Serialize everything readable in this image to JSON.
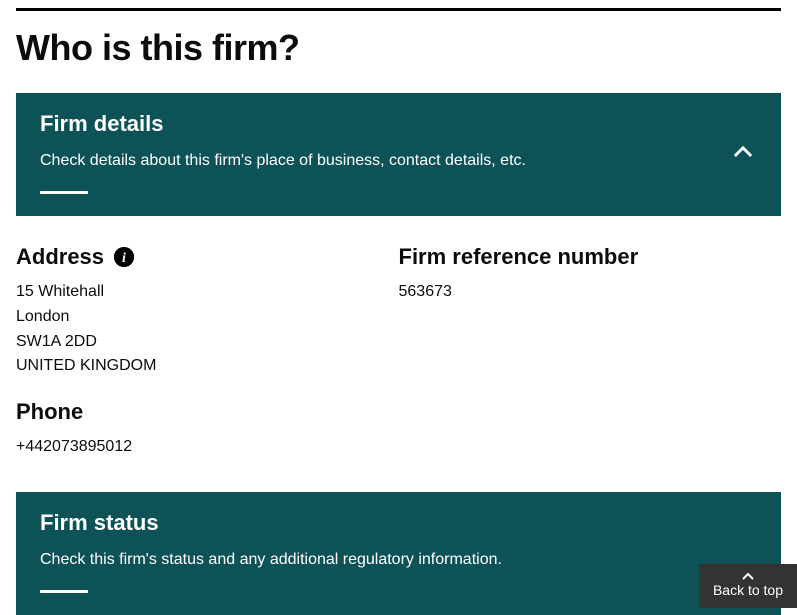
{
  "page": {
    "title": "Who is this firm?"
  },
  "panels": {
    "firmDetails": {
      "title": "Firm details",
      "description": "Check details about this firm's place of business, contact details, etc."
    },
    "firmStatus": {
      "title": "Firm status",
      "description": "Check this firm's status and any additional regulatory information."
    }
  },
  "firm": {
    "addressLabel": "Address",
    "addressLines": {
      "line1": "15 Whitehall",
      "line2": "London",
      "line3": "SW1A 2DD",
      "line4": "UNITED KINGDOM"
    },
    "phoneLabel": "Phone",
    "phoneValue": "+442073895012",
    "frnLabel": "Firm reference number",
    "frnValue": "563673"
  },
  "backToTop": {
    "label": "Back to top"
  }
}
